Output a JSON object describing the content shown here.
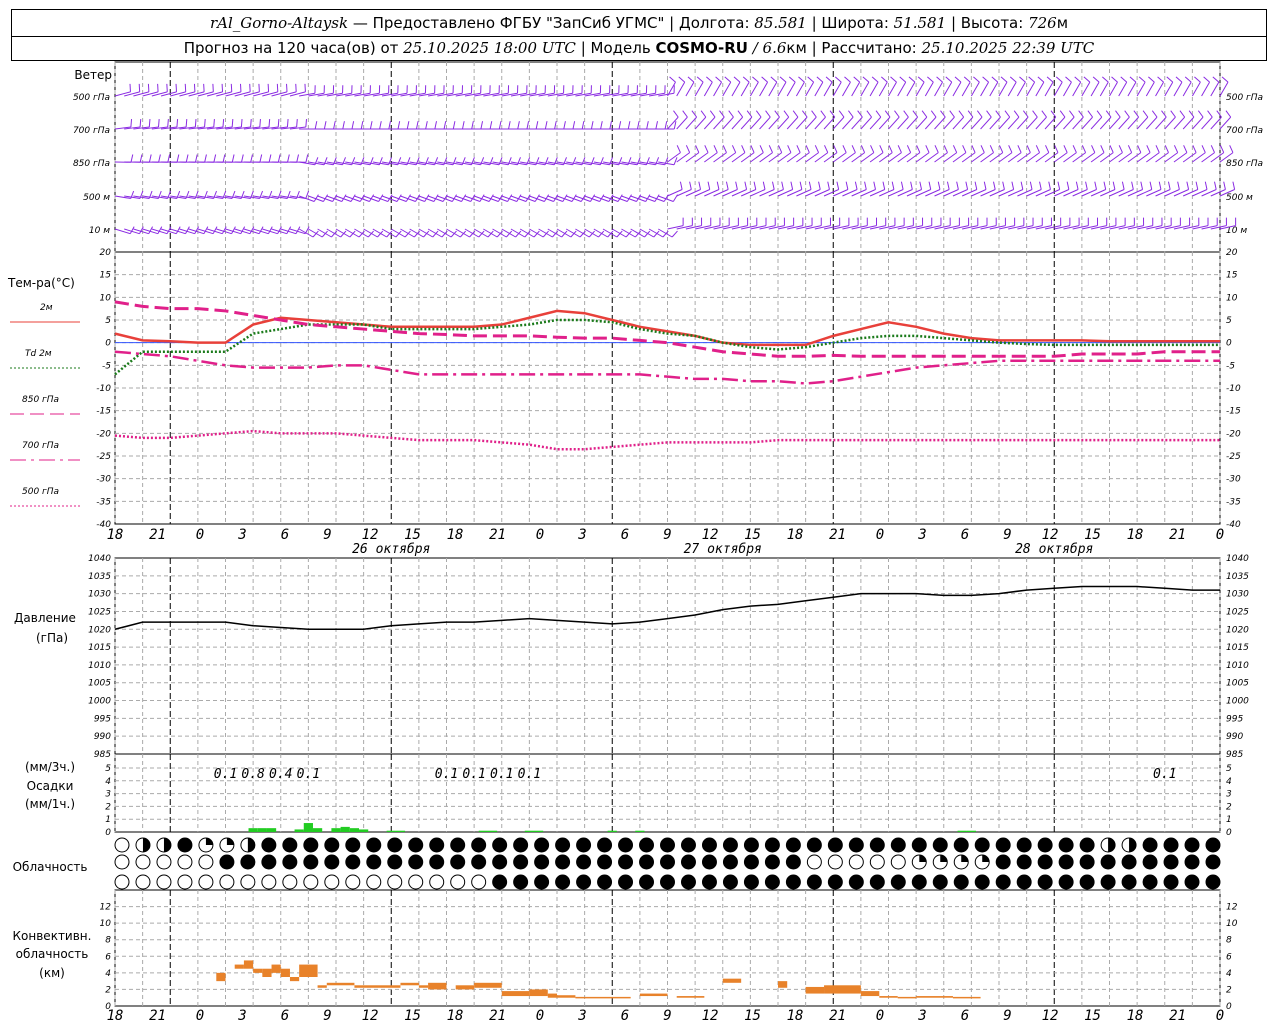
{
  "header": {
    "station": "rAl_Gorno-Altaysk",
    "provider": "— Предоставлено ФГБУ \"ЗапСиб УГМС\" |",
    "lon_label": "Долгота:",
    "lon": "85.581",
    "lat_label": "| Широта:",
    "lat": "51.581",
    "alt_label": "| Высота:",
    "alt": "726",
    "alt_unit": "м",
    "forecast_prefix": "Прогноз на 120 часа(ов) от",
    "forecast_time": "25.10.2025 18:00 UTC",
    "model_label": "| Модель",
    "model": "COSMO-RU",
    "resolution": "/ 6.6",
    "res_unit": "км",
    "calc_label": "| Рассчитано:",
    "calc_time": "25.10.2025 22:39 UTC"
  },
  "wind_panel": {
    "title": "Ветер",
    "levels": [
      "500 гПа",
      "700 гПа",
      "850 гПа",
      "500 м",
      "10  м"
    ],
    "color": "#8a2be2"
  },
  "temp_panel": {
    "title": "Тем-ра(°С)",
    "legend": [
      "2м",
      "Td  2м",
      "850 гПа",
      "700 гПа",
      "500 гПа"
    ]
  },
  "pressure_panel": {
    "title": "Давление",
    "unit": "(гПа)"
  },
  "precip_panel": {
    "unit3": "(мм/3ч.)",
    "title": "Осадки",
    "unit1": "(мм/1ч.)",
    "labels": [
      "0.1",
      "0.8",
      "0.4",
      "0.1",
      "0.1",
      "0.1",
      "0.1",
      "0.1",
      "0.1"
    ]
  },
  "cloud_panel": {
    "title": "Облачность"
  },
  "conv_panel": {
    "title1": "Конвективн.",
    "title2": "облачность",
    "unit": "(км)"
  },
  "x_axis": {
    "labels": [
      "18",
      "21",
      "0",
      "3",
      "6",
      "9",
      "12",
      "15",
      "18",
      "21",
      "0",
      "3",
      "6",
      "9",
      "12",
      "15",
      "18",
      "21",
      "0",
      "3",
      "6",
      "9",
      "12",
      "15",
      "18",
      "21",
      "0"
    ],
    "dates": [
      "26 октября",
      "27 октября",
      "28 октября"
    ]
  },
  "chart_data": [
    {
      "type": "line",
      "title": "Тем-ра(°С)",
      "x_hours": [
        0,
        3,
        6,
        9,
        12,
        15,
        18,
        21,
        24,
        27,
        30,
        33,
        36,
        39,
        42,
        45,
        48,
        51,
        54,
        57,
        60,
        63,
        66,
        69,
        72,
        75,
        78,
        81,
        84,
        87,
        90,
        93,
        96,
        99,
        102,
        105,
        108,
        111,
        114,
        117,
        120
      ],
      "ylim": [
        -40,
        20
      ],
      "yticks": [
        20,
        15,
        10,
        5,
        0,
        -5,
        -10,
        -15,
        -20,
        -25,
        -30,
        -35,
        -40
      ],
      "series": [
        {
          "name": "2м",
          "color": "#e8403a",
          "style": "solid",
          "values": [
            2,
            0.5,
            0.3,
            0,
            0,
            4,
            5.5,
            5,
            4.5,
            4,
            3.5,
            3.5,
            3.5,
            3.5,
            4,
            5.5,
            7,
            6.5,
            5,
            3.5,
            2.5,
            1.5,
            0,
            -0.5,
            -0.5,
            -0.5,
            1.5,
            3,
            4.5,
            3.5,
            2,
            1,
            0.5,
            0.5,
            0.5,
            0.5,
            0.3,
            0.3,
            0.3,
            0.3,
            0.3
          ]
        },
        {
          "name": "Td  2м",
          "color": "#1a7a1a",
          "style": "dotted",
          "values": [
            -7,
            -2,
            -2,
            -2,
            -2,
            2,
            3,
            4,
            4,
            4,
            3,
            3,
            3,
            3,
            3.5,
            4,
            5,
            5,
            4.5,
            3,
            2,
            1.5,
            0,
            -1,
            -1.5,
            -1,
            0,
            1,
            1.5,
            1.5,
            1,
            0.5,
            0,
            -0.3,
            -0.5,
            -0.5,
            -0.5,
            -0.5,
            -0.5,
            -0.5,
            -0.5
          ]
        },
        {
          "name": "850 гПа",
          "color": "#e0208a",
          "style": "longdash",
          "values": [
            9,
            8,
            7.5,
            7.5,
            7,
            6,
            5,
            4,
            3.5,
            3,
            2.5,
            2,
            1.8,
            1.5,
            1.5,
            1.5,
            1.2,
            1,
            1,
            0.5,
            0,
            -1,
            -2,
            -2.5,
            -3,
            -3,
            -2.8,
            -3,
            -3,
            -3,
            -3,
            -3,
            -3,
            -3,
            -3,
            -2.5,
            -2.5,
            -2.5,
            -2,
            -2,
            -2
          ]
        },
        {
          "name": "700 гПа",
          "color": "#e0208a",
          "style": "dashdot",
          "values": [
            -2,
            -2.5,
            -3,
            -4,
            -5,
            -5.5,
            -5.5,
            -5.5,
            -5,
            -5,
            -6,
            -7,
            -7,
            -7,
            -7,
            -7,
            -7,
            -7,
            -7,
            -7,
            -7.5,
            -8,
            -8,
            -8.5,
            -8.5,
            -9,
            -8.5,
            -7.5,
            -6.5,
            -5.5,
            -5,
            -4.5,
            -4,
            -4,
            -4,
            -4,
            -4,
            -4,
            -4,
            -4,
            -4
          ]
        },
        {
          "name": "500 гПа",
          "color": "#e0208a",
          "style": "dotted",
          "values": [
            -20.5,
            -21,
            -21,
            -20.5,
            -20,
            -19.5,
            -20,
            -20,
            -20,
            -20.5,
            -21,
            -21.5,
            -21.5,
            -21.5,
            -22,
            -22.5,
            -23.5,
            -23.5,
            -23,
            -22.5,
            -22,
            -22,
            -22,
            -22,
            -21.5,
            -21.5,
            -21.5,
            -21.5,
            -21.5,
            -21.5,
            -21.5,
            -21.5,
            -21.5,
            -21.5,
            -21.5,
            -21.5,
            -21.5,
            -21.5,
            -21.5,
            -21.5,
            -21.5
          ]
        }
      ]
    },
    {
      "type": "line",
      "title": "Давление",
      "ylabel": "(гПа)",
      "ylim": [
        985,
        1040
      ],
      "yticks": [
        1040,
        1035,
        1030,
        1025,
        1020,
        1015,
        1010,
        1005,
        1000,
        995,
        990,
        985
      ],
      "x_hours": [
        0,
        3,
        6,
        9,
        12,
        15,
        18,
        21,
        24,
        27,
        30,
        33,
        36,
        39,
        42,
        45,
        48,
        51,
        54,
        57,
        60,
        63,
        66,
        69,
        72,
        75,
        78,
        81,
        84,
        87,
        90,
        93,
        96,
        99,
        102,
        105,
        108,
        111,
        114,
        117,
        120
      ],
      "values": [
        1020,
        1022,
        1022,
        1022,
        1022,
        1021,
        1020.5,
        1020,
        1020,
        1020,
        1021,
        1021.5,
        1022,
        1022,
        1022.5,
        1023,
        1022.5,
        1022,
        1021.5,
        1022,
        1023,
        1024,
        1025.5,
        1026.5,
        1027,
        1028,
        1029,
        1030,
        1030,
        1030,
        1029.5,
        1029.5,
        1030,
        1031,
        1031.5,
        1032,
        1032,
        1032,
        1031.5,
        1031,
        1031
      ]
    },
    {
      "type": "bar",
      "title": "Осадки",
      "ylim": [
        0,
        5
      ],
      "yticks": [
        5,
        4,
        3,
        2,
        1,
        0
      ],
      "bars": [
        {
          "hour": 15,
          "value": 0.3
        },
        {
          "hour": 16,
          "value": 0.3
        },
        {
          "hour": 17,
          "value": 0.3
        },
        {
          "hour": 20,
          "value": 0.2
        },
        {
          "hour": 21,
          "value": 0.7
        },
        {
          "hour": 22,
          "value": 0.3
        },
        {
          "hour": 24,
          "value": 0.3
        },
        {
          "hour": 25,
          "value": 0.4
        },
        {
          "hour": 26,
          "value": 0.3
        },
        {
          "hour": 27,
          "value": 0.2
        },
        {
          "hour": 30,
          "value": 0.1
        },
        {
          "hour": 31,
          "value": 0.1
        },
        {
          "hour": 40,
          "value": 0.1
        },
        {
          "hour": 41,
          "value": 0.1
        },
        {
          "hour": 45,
          "value": 0.1
        },
        {
          "hour": 46,
          "value": 0.1
        },
        {
          "hour": 54,
          "value": 0.1
        },
        {
          "hour": 57,
          "value": 0.1
        },
        {
          "hour": 92,
          "value": 0.1
        },
        {
          "hour": 93,
          "value": 0.1
        }
      ],
      "labels_at_hours": [
        12,
        15,
        18,
        21,
        36,
        39,
        42,
        45,
        114
      ]
    },
    {
      "type": "bar",
      "title": "Конвективн. облачность",
      "ylabel": "(км)",
      "ylim": [
        0,
        14
      ],
      "yticks": [
        12,
        10,
        8,
        6,
        4,
        2,
        0
      ],
      "bars": [
        {
          "h0": 11,
          "h1": 12,
          "base": 3,
          "top": 4
        },
        {
          "h0": 13,
          "h1": 14,
          "base": 4.5,
          "top": 5
        },
        {
          "h0": 14,
          "h1": 15,
          "base": 4.5,
          "top": 5.5
        },
        {
          "h0": 15,
          "h1": 16,
          "base": 4,
          "top": 4.5
        },
        {
          "h0": 16,
          "h1": 17,
          "base": 3.5,
          "top": 4.5
        },
        {
          "h0": 17,
          "h1": 18,
          "base": 4,
          "top": 5
        },
        {
          "h0": 18,
          "h1": 19,
          "base": 3.5,
          "top": 4.5
        },
        {
          "h0": 19,
          "h1": 20,
          "base": 3,
          "top": 3.5
        },
        {
          "h0": 20,
          "h1": 22,
          "base": 3.5,
          "top": 5
        },
        {
          "h0": 22,
          "h1": 23,
          "base": 2.2,
          "top": 2.5
        },
        {
          "h0": 23,
          "h1": 26,
          "base": 2.5,
          "top": 2.8
        },
        {
          "h0": 26,
          "h1": 31,
          "base": 2.2,
          "top": 2.5
        },
        {
          "h0": 31,
          "h1": 33,
          "base": 2.5,
          "top": 2.8
        },
        {
          "h0": 33,
          "h1": 34,
          "base": 2.2,
          "top": 2.5
        },
        {
          "h0": 34,
          "h1": 36,
          "base": 2,
          "top": 2.8
        },
        {
          "h0": 37,
          "h1": 39,
          "base": 2,
          "top": 2.5
        },
        {
          "h0": 39,
          "h1": 42,
          "base": 2.2,
          "top": 2.8
        },
        {
          "h0": 42,
          "h1": 45,
          "base": 1.2,
          "top": 1.8
        },
        {
          "h0": 45,
          "h1": 47,
          "base": 1.2,
          "top": 2
        },
        {
          "h0": 47,
          "h1": 48,
          "base": 1,
          "top": 1.5
        },
        {
          "h0": 48,
          "h1": 50,
          "base": 1,
          "top": 1.3
        },
        {
          "h0": 50,
          "h1": 56,
          "base": 1,
          "top": 1.1
        },
        {
          "h0": 57,
          "h1": 60,
          "base": 1.2,
          "top": 1.5
        },
        {
          "h0": 61,
          "h1": 64,
          "base": 1,
          "top": 1.2
        },
        {
          "h0": 66,
          "h1": 68,
          "base": 2.8,
          "top": 3.3
        },
        {
          "h0": 72,
          "h1": 73,
          "base": 2.2,
          "top": 3
        },
        {
          "h0": 75,
          "h1": 77,
          "base": 1.5,
          "top": 2.3
        },
        {
          "h0": 77,
          "h1": 81,
          "base": 1.5,
          "top": 2.5
        },
        {
          "h0": 81,
          "h1": 83,
          "base": 1.2,
          "top": 1.8
        },
        {
          "h0": 83,
          "h1": 85,
          "base": 1,
          "top": 1.2
        },
        {
          "h0": 85,
          "h1": 87,
          "base": 1,
          "top": 1.1
        },
        {
          "h0": 87,
          "h1": 91,
          "base": 1,
          "top": 1.2
        },
        {
          "h0": 91,
          "h1": 94,
          "base": 1,
          "top": 1.1
        }
      ],
      "color": "#e8822a"
    }
  ],
  "cloud_rows": {
    "top": "ehhfqqhffffffffffffffffffffffffffffffffffffffffhhfffffffffffffeeeeeeeeeeeeeeeeeeeeeeeeeeeeeeeeeee",
    "mid": "eeeeeffffffffffffffffffffffffffffeeeeeqqqqffffffffffffffffeeeeeeeeeeeeeeeeeeeeeeeeeeeeeeeeeeee",
    "low": "eeeeeeeeeeeeeeeeeefffffffffffffffffffffffffffffffffffffffffffffffffffffffffffffffffffffffffff"
  }
}
